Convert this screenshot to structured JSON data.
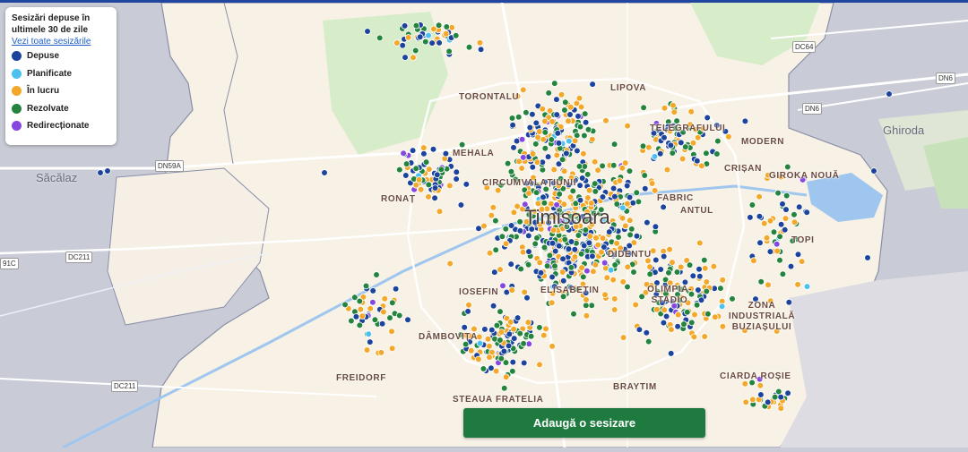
{
  "legend": {
    "title": "Sesizări depuse în ultimele 30 de zile",
    "link": "Vezi toate sesizările",
    "items": [
      {
        "label": "Depuse",
        "color": "#1c449c"
      },
      {
        "label": "Planificate",
        "color": "#4cc1f0"
      },
      {
        "label": "În lucru",
        "color": "#f3a829"
      },
      {
        "label": "Rezolvate",
        "color": "#24843e"
      },
      {
        "label": "Redirecționate",
        "color": "#8646e0"
      }
    ]
  },
  "map": {
    "city": "Timișoara",
    "neighborhoods": [
      "TORONTALU",
      "IOSEFIN",
      "ELISABETIN",
      "DÂMBOVIȚA",
      "STEAUA",
      "FRATELIA",
      "BRAYTIM",
      "CIARDA ROȘIE",
      "ZONA INDUSTRIALĂ BUZIAȘULUI",
      "MODERN",
      "CRIȘAN",
      "GIROKA NOUĂ",
      "TOPI",
      "TELEGRAFULUI",
      "FABRIC",
      "MEHALA",
      "RONAȚ",
      "CIRCUMVALAȚIUNII",
      "LIPOVA",
      "FREIDORF",
      "OLIMPIA-STADIO",
      "DIDENTU",
      "ANTUL"
    ],
    "localities": [
      "Săcălaz",
      "Ghiroda"
    ],
    "roads": [
      "DN59A",
      "DC211",
      "DC211",
      "DC64",
      "DN6",
      "DN6",
      "91C"
    ]
  },
  "actions": {
    "add_report": "Adaugă o sesizare"
  }
}
